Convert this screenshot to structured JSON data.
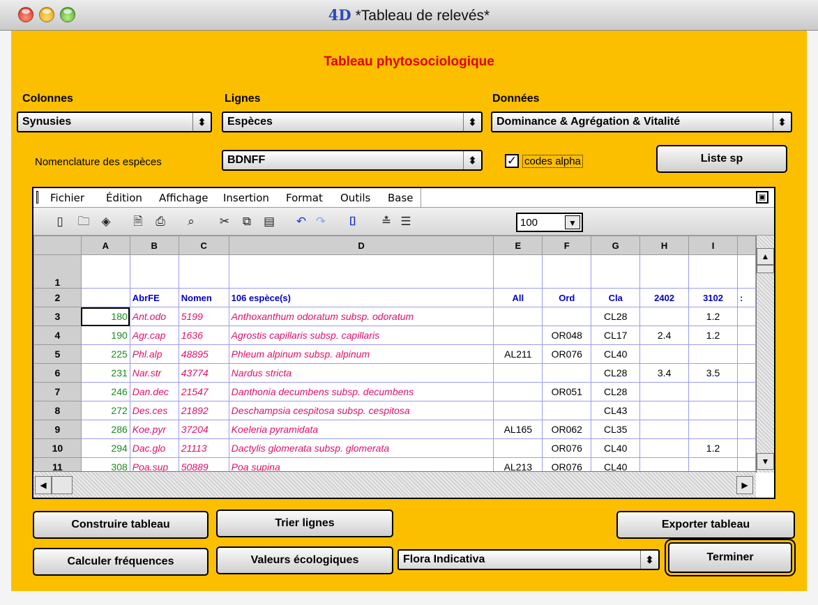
{
  "window": {
    "title": "*Tableau de relevés*",
    "app_logo": "4D"
  },
  "heading": "Tableau phytosociologique",
  "labels": {
    "colonnes": "Colonnes",
    "lignes": "Lignes",
    "donnees": "Données",
    "nomenclature": "Nomenclature des espèces"
  },
  "popups": {
    "colonnes": "Synusies",
    "lignes": "Espèces",
    "donnees": "Dominance & Agrégation & Vitalité",
    "nomenclature": "BDNFF",
    "flora": "Flora Indicativa"
  },
  "checkbox": {
    "label": "codes alpha",
    "checked": true
  },
  "buttons": {
    "liste_sp": "Liste sp",
    "construire": "Construire tableau",
    "trier": "Trier lignes",
    "exporter": "Exporter tableau",
    "calculer": "Calculer fréquences",
    "valeurs": "Valeurs écologiques",
    "terminer": "Terminer"
  },
  "spreadsheet": {
    "menu": [
      "Fichier",
      "Édition",
      "Affichage",
      "Insertion",
      "Format",
      "Outils",
      "Base"
    ],
    "zoom": "100",
    "columns": [
      "A",
      "B",
      "C",
      "D",
      "E",
      "F",
      "G",
      "H",
      "I"
    ],
    "header_row": {
      "B": "AbrFE",
      "C": "Nomen",
      "D": "106 espèce(s)",
      "E": "All",
      "F": "Ord",
      "G": "Cla",
      "H": "2402",
      "I": "3102"
    },
    "rows": [
      {
        "n": "1",
        "A": "",
        "B": "",
        "C": "",
        "D": "",
        "E": "",
        "F": "",
        "G": "",
        "H": "",
        "I": ""
      },
      {
        "n": "3",
        "A": "180",
        "B": "Ant.odo",
        "C": "5199",
        "D": "Anthoxanthum odoratum subsp. odoratum",
        "E": "",
        "F": "",
        "G": "CL28",
        "H": "",
        "I": "1.2"
      },
      {
        "n": "4",
        "A": "190",
        "B": "Agr.cap",
        "C": "1636",
        "D": "Agrostis capillaris subsp. capillaris",
        "E": "",
        "F": "OR048",
        "G": "CL17",
        "H": "2.4",
        "I": "1.2"
      },
      {
        "n": "5",
        "A": "225",
        "B": "Phl.alp",
        "C": "48895",
        "D": "Phleum alpinum subsp. alpinum",
        "E": "AL211",
        "F": "OR076",
        "G": "CL40",
        "H": "",
        "I": ""
      },
      {
        "n": "6",
        "A": "231",
        "B": "Nar.str",
        "C": "43774",
        "D": "Nardus stricta",
        "E": "",
        "F": "",
        "G": "CL28",
        "H": "3.4",
        "I": "3.5"
      },
      {
        "n": "7",
        "A": "246",
        "B": "Dan.dec",
        "C": "21547",
        "D": "Danthonia decumbens subsp. decumbens",
        "E": "",
        "F": "OR051",
        "G": "CL28",
        "H": "",
        "I": ""
      },
      {
        "n": "8",
        "A": "272",
        "B": "Des.ces",
        "C": "21892",
        "D": "Deschampsia cespitosa subsp. cespitosa",
        "E": "",
        "F": "",
        "G": "CL43",
        "H": "",
        "I": ""
      },
      {
        "n": "9",
        "A": "286",
        "B": "Koe.pyr",
        "C": "37204",
        "D": "Koeleria pyramidata",
        "E": "AL165",
        "F": "OR062",
        "G": "CL35",
        "H": "",
        "I": ""
      },
      {
        "n": "10",
        "A": "294",
        "B": "Dac.glo",
        "C": "21113",
        "D": "Dactylis glomerata subsp. glomerata",
        "E": "",
        "F": "OR076",
        "G": "CL40",
        "H": "",
        "I": "1.2"
      },
      {
        "n": "11",
        "A": "308",
        "B": "Poa.sup",
        "C": "50889",
        "D": "Poa supina",
        "E": "AL213",
        "F": "OR076",
        "G": "CL40",
        "H": "",
        "I": ""
      }
    ]
  }
}
